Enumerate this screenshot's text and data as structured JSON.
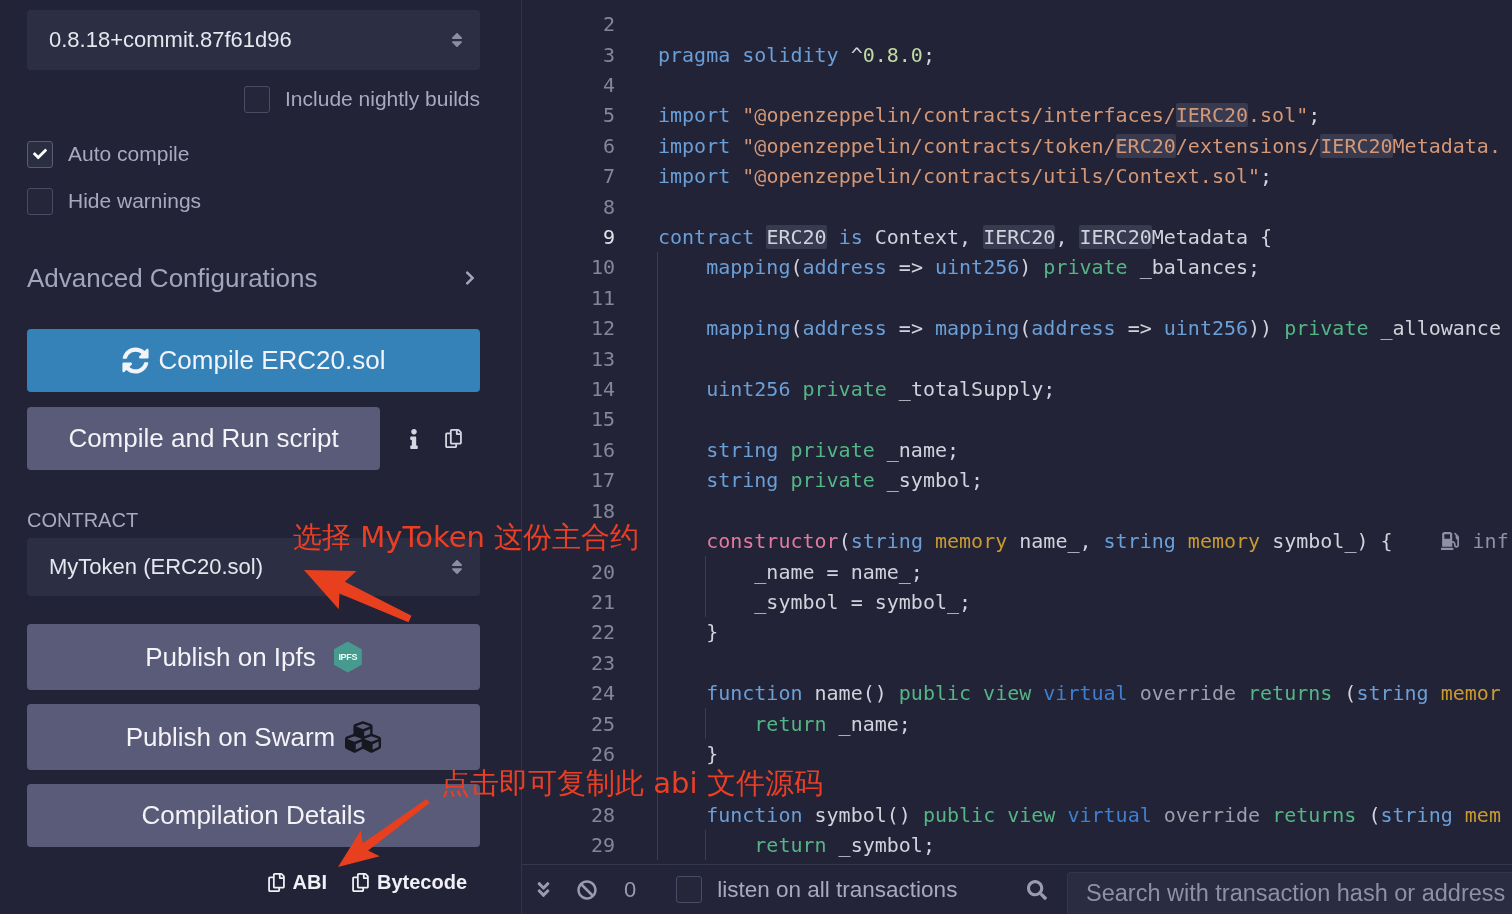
{
  "compiler": {
    "version": "0.8.18+commit.87f61d96"
  },
  "nightly_builds": {
    "label": "Include nightly builds",
    "checked": false
  },
  "options": [
    {
      "label": "Auto compile",
      "checked": true
    },
    {
      "label": "Hide warnings",
      "checked": false
    }
  ],
  "advanced": {
    "label": "Advanced Configurations",
    "expanded": false
  },
  "compile_button": "Compile ERC20.sol",
  "run_script_button": "Compile and Run script",
  "contract": {
    "label": "CONTRACT",
    "value": "MyToken (ERC20.sol)"
  },
  "publish_buttons": [
    {
      "kind": "ipfs",
      "label": "Publish on Ipfs",
      "badge": "IPFS"
    },
    {
      "kind": "swarm",
      "label": "Publish on Swarm"
    }
  ],
  "details_button": "Compilation Details",
  "copy_links": [
    "ABI",
    "Bytecode"
  ],
  "editor": {
    "lines": [
      {
        "number": "2",
        "current": false
      },
      {
        "number": "3",
        "current": false,
        "tokens": [
          {
            "kind": "keyword",
            "text": "pragma solidity "
          },
          {
            "kind": "plain",
            "text": "^"
          },
          {
            "kind": "number",
            "text": "0.8.0"
          },
          {
            "kind": "plain",
            "text": ";"
          }
        ]
      },
      {
        "number": "4",
        "current": false
      },
      {
        "number": "5",
        "current": false,
        "tokens": [
          {
            "kind": "keyword",
            "text": "import "
          },
          {
            "kind": "string",
            "text": "\"@openzeppelin/contracts/interfaces/"
          },
          {
            "kind": "string",
            "text": "IERC20",
            "highlighted": true
          },
          {
            "kind": "string",
            "text": ".sol\""
          },
          {
            "kind": "plain",
            "text": ";"
          }
        ]
      },
      {
        "number": "6",
        "current": false,
        "tokens": [
          {
            "kind": "keyword",
            "text": "import "
          },
          {
            "kind": "string",
            "text": "\"@openzeppelin/contracts/token/"
          },
          {
            "kind": "string",
            "text": "ERC20",
            "highlighted": true
          },
          {
            "kind": "string",
            "text": "/extensions/"
          },
          {
            "kind": "string",
            "text": "IERC20",
            "highlighted": true
          },
          {
            "kind": "string",
            "text": "Metadata."
          }
        ]
      },
      {
        "number": "7",
        "current": false,
        "tokens": [
          {
            "kind": "keyword",
            "text": "import "
          },
          {
            "kind": "string",
            "text": "\"@openzeppelin/contracts/utils/Context.sol\""
          },
          {
            "kind": "plain",
            "text": ";"
          }
        ]
      },
      {
        "number": "8",
        "current": false
      },
      {
        "number": "9",
        "current": true,
        "tokens": [
          {
            "kind": "keyword",
            "text": "contract "
          },
          {
            "kind": "plain",
            "text": "ERC20",
            "highlighted": true
          },
          {
            "kind": "keyword",
            "text": " is "
          },
          {
            "kind": "plain",
            "text": "Context, "
          },
          {
            "kind": "plain",
            "text": "IERC20",
            "highlighted": true
          },
          {
            "kind": "plain",
            "text": ", "
          },
          {
            "kind": "plain",
            "text": "IERC20",
            "highlighted": true
          },
          {
            "kind": "plain",
            "text": "Metadata {"
          }
        ]
      },
      {
        "number": "10",
        "current": false,
        "tokens": [
          {
            "kind": "keyword",
            "text": "    mapping"
          },
          {
            "kind": "plain",
            "text": "("
          },
          {
            "kind": "keyword",
            "text": "address"
          },
          {
            "kind": "plain",
            "text": " => "
          },
          {
            "kind": "keyword",
            "text": "uint256"
          },
          {
            "kind": "plain",
            "text": ") "
          },
          {
            "kind": "visibility",
            "text": "private"
          },
          {
            "kind": "plain",
            "text": " _balances;"
          }
        ]
      },
      {
        "number": "11",
        "current": false
      },
      {
        "number": "12",
        "current": false,
        "tokens": [
          {
            "kind": "keyword",
            "text": "    mapping"
          },
          {
            "kind": "plain",
            "text": "("
          },
          {
            "kind": "keyword",
            "text": "address"
          },
          {
            "kind": "plain",
            "text": " => "
          },
          {
            "kind": "keyword",
            "text": "mapping"
          },
          {
            "kind": "plain",
            "text": "("
          },
          {
            "kind": "keyword",
            "text": "address"
          },
          {
            "kind": "plain",
            "text": " => "
          },
          {
            "kind": "keyword",
            "text": "uint256"
          },
          {
            "kind": "plain",
            "text": ")) "
          },
          {
            "kind": "visibility",
            "text": "private"
          },
          {
            "kind": "plain",
            "text": " _allowance"
          }
        ]
      },
      {
        "number": "13",
        "current": false
      },
      {
        "number": "14",
        "current": false,
        "tokens": [
          {
            "kind": "keyword",
            "text": "    uint256 "
          },
          {
            "kind": "visibility",
            "text": "private"
          },
          {
            "kind": "plain",
            "text": " _totalSupply;"
          }
        ]
      },
      {
        "number": "15",
        "current": false
      },
      {
        "number": "16",
        "current": false,
        "tokens": [
          {
            "kind": "keyword",
            "text": "    string "
          },
          {
            "kind": "visibility",
            "text": "private"
          },
          {
            "kind": "plain",
            "text": " _name;"
          }
        ]
      },
      {
        "number": "17",
        "current": false,
        "tokens": [
          {
            "kind": "keyword",
            "text": "    string "
          },
          {
            "kind": "visibility",
            "text": "private"
          },
          {
            "kind": "plain",
            "text": " _symbol;"
          }
        ]
      },
      {
        "number": "18",
        "current": false
      },
      {
        "gas_hint": "inf",
        "tokens": [
          {
            "kind": "constructor",
            "text": "    constructor"
          },
          {
            "kind": "plain",
            "text": "("
          },
          {
            "kind": "keyword",
            "text": "string "
          },
          {
            "kind": "storage",
            "text": "memory"
          },
          {
            "kind": "plain",
            "text": " name_, "
          },
          {
            "kind": "keyword",
            "text": "string "
          },
          {
            "kind": "storage",
            "text": "memory"
          },
          {
            "kind": "plain",
            "text": " symbol_) {"
          }
        ]
      },
      {
        "number": "20",
        "current": false,
        "tokens": [
          {
            "kind": "plain",
            "text": "        _name = name_;"
          }
        ]
      },
      {
        "number": "21",
        "current": false,
        "tokens": [
          {
            "kind": "plain",
            "text": "        _symbol = symbol_;"
          }
        ]
      },
      {
        "number": "22",
        "current": false,
        "tokens": [
          {
            "kind": "plain",
            "text": "    }"
          }
        ]
      },
      {
        "number": "23",
        "current": false
      },
      {
        "number": "24",
        "current": false,
        "tokens": [
          {
            "kind": "keyword",
            "text": "    function"
          },
          {
            "kind": "plain",
            "text": " name() "
          },
          {
            "kind": "visibility",
            "text": "public view "
          },
          {
            "kind": "virtual",
            "text": "virtual "
          },
          {
            "kind": "override",
            "text": "override "
          },
          {
            "kind": "visibility",
            "text": "returns "
          },
          {
            "kind": "plain",
            "text": "("
          },
          {
            "kind": "keyword",
            "text": "string "
          },
          {
            "kind": "storage",
            "text": "memor"
          }
        ]
      },
      {
        "number": "25",
        "current": false,
        "tokens": [
          {
            "kind": "visibility",
            "text": "        return"
          },
          {
            "kind": "plain",
            "text": " _name;"
          }
        ]
      },
      {
        "number": "26",
        "current": false,
        "tokens": [
          {
            "kind": "plain",
            "text": "    }"
          }
        ]
      },
      {
        "number": "28",
        "current": false,
        "tokens": [
          {
            "kind": "keyword",
            "text": "    function"
          },
          {
            "kind": "plain",
            "text": " symbol() "
          },
          {
            "kind": "visibility",
            "text": "public view "
          },
          {
            "kind": "virtual",
            "text": "virtual "
          },
          {
            "kind": "override",
            "text": "override "
          },
          {
            "kind": "visibility",
            "text": "returns "
          },
          {
            "kind": "plain",
            "text": "("
          },
          {
            "kind": "keyword",
            "text": "string "
          },
          {
            "kind": "storage",
            "text": "mem"
          }
        ]
      },
      {
        "number": "29",
        "current": false,
        "tokens": [
          {
            "kind": "visibility",
            "text": "        return"
          },
          {
            "kind": "plain",
            "text": " _symbol;"
          }
        ]
      }
    ]
  },
  "terminal": {
    "count": "0",
    "listen": {
      "label": "listen on all transactions",
      "checked": false
    },
    "search": {
      "placeholder": "Search with transaction hash or address"
    }
  },
  "annotations": [
    {
      "text": "选择 MyToken 这份主合约"
    },
    {
      "text": "点击即可复制此 abi 文件源码"
    }
  ]
}
